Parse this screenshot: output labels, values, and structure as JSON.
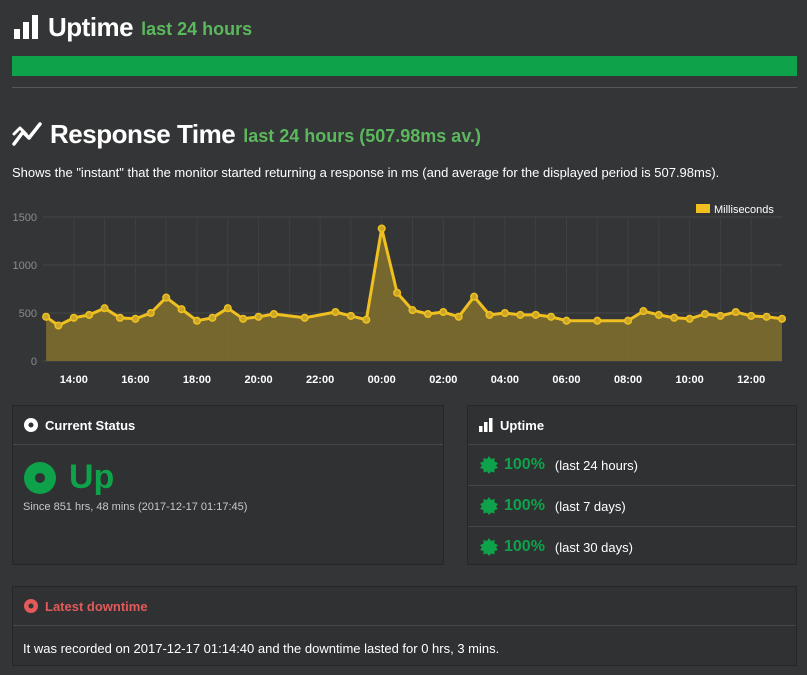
{
  "uptime_header": {
    "title": "Uptime",
    "subtitle": "last 24 hours",
    "bar_percent": 100
  },
  "response_header": {
    "title": "Response Time",
    "subtitle": "last 24 hours (507.98ms av.)"
  },
  "description": "Shows the \"instant\" that the monitor started returning a response in ms (and average for the displayed period is 507.98ms).",
  "chart_data": {
    "type": "area",
    "legend": "Milliseconds",
    "legend_position": "top-right",
    "ylim": [
      0,
      1500
    ],
    "y_ticks": [
      "0",
      "500",
      "1000",
      "1500"
    ],
    "x_ticks": [
      "14:00",
      "16:00",
      "18:00",
      "20:00",
      "22:00",
      "00:00",
      "02:00",
      "04:00",
      "06:00",
      "08:00",
      "10:00",
      "12:00"
    ],
    "x_hours": [
      13.1,
      13.5,
      14.0,
      14.5,
      15.0,
      15.5,
      16.0,
      16.5,
      17.0,
      17.5,
      18.0,
      18.5,
      19.0,
      19.5,
      20.0,
      20.5,
      21.5,
      22.5,
      23.0,
      23.5,
      24.0,
      24.5,
      25.0,
      25.5,
      26.0,
      26.5,
      27.0,
      27.5,
      28.0,
      28.5,
      29.0,
      29.5,
      30.0,
      31.0,
      32.0,
      32.5,
      33.0,
      33.5,
      34.0,
      34.5,
      35.0,
      35.5,
      36.0,
      36.5,
      37.0
    ],
    "y_values": [
      460,
      370,
      450,
      480,
      550,
      450,
      440,
      500,
      660,
      540,
      420,
      450,
      550,
      440,
      460,
      490,
      450,
      510,
      470,
      430,
      1380,
      710,
      530,
      490,
      510,
      460,
      670,
      480,
      500,
      480,
      480,
      460,
      420,
      420,
      420,
      520,
      480,
      450,
      440,
      490,
      470,
      510,
      470,
      460,
      440,
      380
    ],
    "line_color": "#f0c020",
    "fill_color": "#7a6a2e",
    "grid": true
  },
  "current_status": {
    "title": "Current Status",
    "status": "Up",
    "since": "Since 851 hrs, 48 mins (2017-12-17 01:17:45)",
    "color": "#0ea34a"
  },
  "uptime_panel": {
    "title": "Uptime",
    "rows": [
      {
        "pct": "100%",
        "period": "(last 24 hours)"
      },
      {
        "pct": "100%",
        "period": "(last 7 days)"
      },
      {
        "pct": "100%",
        "period": "(last 30 days)"
      }
    ]
  },
  "latest_downtime": {
    "title": "Latest downtime",
    "text": "It was recorded on 2017-12-17 01:14:40 and the downtime lasted for 0 hrs, 3 mins.",
    "color": "#e25a5a"
  }
}
